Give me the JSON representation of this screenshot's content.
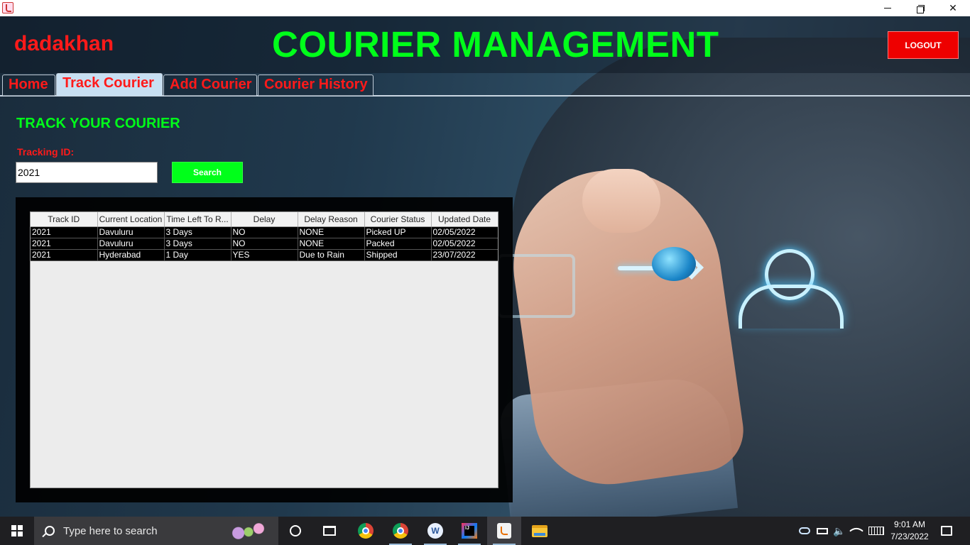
{
  "window": {
    "icon": "java-icon",
    "controls": {
      "minimize": "minimize-icon",
      "maximize": "restore-icon",
      "close": "close-icon"
    }
  },
  "header": {
    "username": "dadakhan",
    "title": "COURIER MANAGEMENT",
    "logout_label": "LOGOUT"
  },
  "tabs": [
    {
      "label": "Home",
      "active": false
    },
    {
      "label": "Track Courier",
      "active": true
    },
    {
      "label": "Add Courier",
      "active": false
    },
    {
      "label": "Courier History",
      "active": false
    }
  ],
  "track": {
    "section_title": "TRACK YOUR COURIER",
    "field_label": "Tracking ID:",
    "tracking_id_value": "2021",
    "search_label": "Search"
  },
  "table": {
    "columns": [
      "Track ID",
      "Current Location",
      "Time Left To R...",
      "Delay",
      "Delay Reason",
      "Courier Status",
      "Updated Date"
    ],
    "rows": [
      [
        "2021",
        "Davuluru",
        "3 Days",
        "NO",
        "NONE",
        "Picked UP",
        "02/05/2022"
      ],
      [
        "2021",
        "Davuluru",
        "3 Days",
        "NO",
        "NONE",
        "Packed",
        "02/05/2022"
      ],
      [
        "2021",
        "Hyderabad",
        "1 Day",
        "YES",
        "Due to Rain",
        "Shipped",
        "23/07/2022"
      ]
    ]
  },
  "taskbar": {
    "search_placeholder": "Type here to search",
    "apps": [
      "cortana-icon",
      "task-view-icon",
      "chrome-icon",
      "chrome-profile-icon",
      "word-icon",
      "intellij-icon",
      "java-app-icon",
      "file-explorer-icon"
    ],
    "time": "9:01 AM",
    "date": "7/23/2022"
  },
  "colors": {
    "accent_red": "#ff1a1a",
    "accent_green": "#00ff1a",
    "logout_bg": "#ee0000",
    "active_tab_bg": "#c7dff2"
  }
}
